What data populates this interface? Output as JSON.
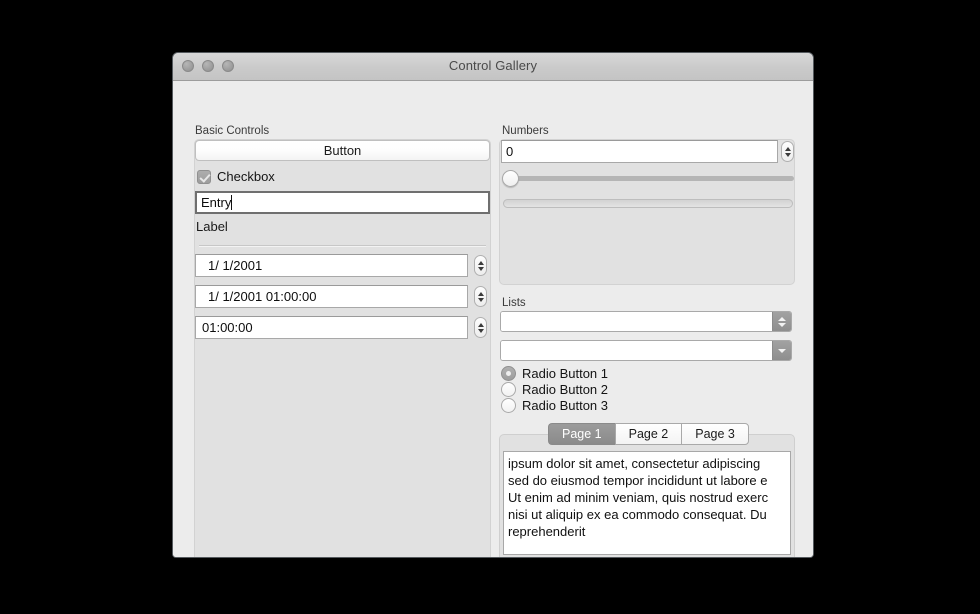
{
  "window": {
    "title": "Control Gallery",
    "traffic_lights": [
      "close-button",
      "minimize-button",
      "zoom-button"
    ]
  },
  "basic_controls": {
    "group_label": "Basic Controls",
    "button_label": "Button",
    "checkbox": {
      "label": "Checkbox",
      "checked": true
    },
    "entry": {
      "value": "Entry",
      "placeholder": ""
    },
    "label": "Label",
    "date_spinner": {
      "value": "1/  1/2001"
    },
    "datetime_spinner": {
      "value": "1/  1/2001 01:00:00"
    },
    "time_spinner": {
      "value": "01:00:00"
    }
  },
  "numbers": {
    "group_label": "Numbers",
    "spinbox": {
      "value": "0"
    },
    "slider": {
      "value": 0,
      "min": 0,
      "max": 100
    },
    "progress": {
      "value": 0,
      "min": 0,
      "max": 100
    }
  },
  "lists": {
    "group_label": "Lists",
    "editable_combo": {
      "value": ""
    },
    "dropdown_combo": {
      "value": ""
    },
    "radios": [
      {
        "label": "Radio Button 1",
        "selected": true
      },
      {
        "label": "Radio Button 2",
        "selected": false
      },
      {
        "label": "Radio Button 3",
        "selected": false
      }
    ]
  },
  "tabs": {
    "items": [
      {
        "label": "Page 1",
        "active": true
      },
      {
        "label": "Page 2",
        "active": false
      },
      {
        "label": "Page 3",
        "active": false
      }
    ],
    "text_lines": [
      " ipsum dolor sit amet, consectetur adipiscing",
      "sed do eiusmod tempor incididunt ut labore e",
      "Ut enim ad minim veniam, quis nostrud exerc",
      "nisi ut aliquip ex ea commodo consequat. Du",
      "reprehenderit"
    ]
  },
  "colors": {
    "window_bg": "#ececec",
    "panel_bg": "#e1e1e1",
    "titlebar": "#cfcfcf",
    "accent_selected_tab": "#8b8b8b",
    "field_bg": "#ffffff"
  }
}
